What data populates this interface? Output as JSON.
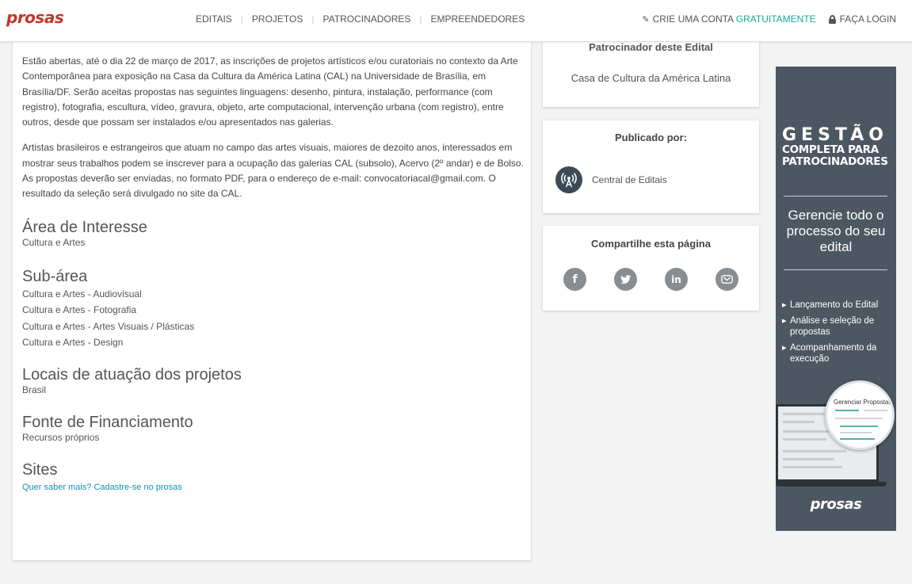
{
  "header": {
    "logo": "prosas",
    "nav": [
      "EDITAIS",
      "PROJETOS",
      "PATROCINADORES",
      "EMPREENDEDORES"
    ],
    "create_account": "CRIE UMA CONTA",
    "create_account_highlight": "GRATUITAMENTE",
    "login": "FAÇA LOGIN"
  },
  "main": {
    "paragraphs": [
      "Estão abertas, até o dia 22 de março de 2017, as inscrições de projetos artísticos e/ou curatoriais no contexto da Arte Contemporânea para exposição na Casa da Cultura da América Latina (CAL) na Universidade de Brasília, em Brasília/DF. Serão aceitas propostas nas seguintes linguagens: desenho, pintura, instalação, performance (com registro), fotografia, escultura, vídeo, gravura, objeto, arte computacional, intervenção urbana (com registro), entre outros, desde que possam ser instalados e/ou apresentados nas galerias.",
      "Artistas brasileiros e estrangeiros que atuam no campo das artes visuais, maiores de dezoito anos, interessados em mostrar seus trabalhos podem se inscrever para a ocupação das galerias CAL (subsolo), Acervo (2º andar) e de Bolso. As propostas deverão ser enviadas, no formato PDF, para o endereço de e-mail: convocatoriacal@gmail.com. O resultado da seleção será divulgado no site da CAL."
    ],
    "area_title": "Área de Interesse",
    "area_value": "Cultura e Artes",
    "subarea_title": "Sub-área",
    "subareas": [
      "Cultura e Artes - Audiovisual",
      "Cultura e Artes - Fotografia",
      "Cultura e Artes - Artes Visuais / Plásticas",
      "Cultura e Artes - Design"
    ],
    "locais_title": "Locais de atuação dos projetos",
    "locais_value": "Brasil",
    "fonte_title": "Fonte de Financiamento",
    "fonte_value": "Recursos próprios",
    "sites_title": "Sites",
    "sites_link": "Quer saber mais? Cadastre-se no prosas"
  },
  "sidebar": {
    "sponsor_title": "Patrocinador deste Edital",
    "sponsor_name": "Casa de Cultura da América Latina",
    "published_title": "Publicado por:",
    "publisher": "Central de Editais",
    "share_title": "Compartilhe esta página",
    "share_icons": [
      "facebook-icon",
      "twitter-icon",
      "linkedin-icon",
      "email-icon"
    ]
  },
  "ad": {
    "headline": "GESTÃO",
    "headline_sub": "COMPLETA PARA PATROCINADORES",
    "tagline": "Gerencie todo o processo do seu edital",
    "bullets": [
      "Lançamento do Edital",
      "Análise e seleção de propostas",
      "Acompanhamento da execução"
    ],
    "screen_title": "Gerenciar Propostas",
    "logo": "prosas"
  },
  "colors": {
    "brand_red": "#c0392b",
    "accent_teal": "#19a89d",
    "link_blue": "#1a8fb3",
    "ad_bg": "#4d5762"
  }
}
